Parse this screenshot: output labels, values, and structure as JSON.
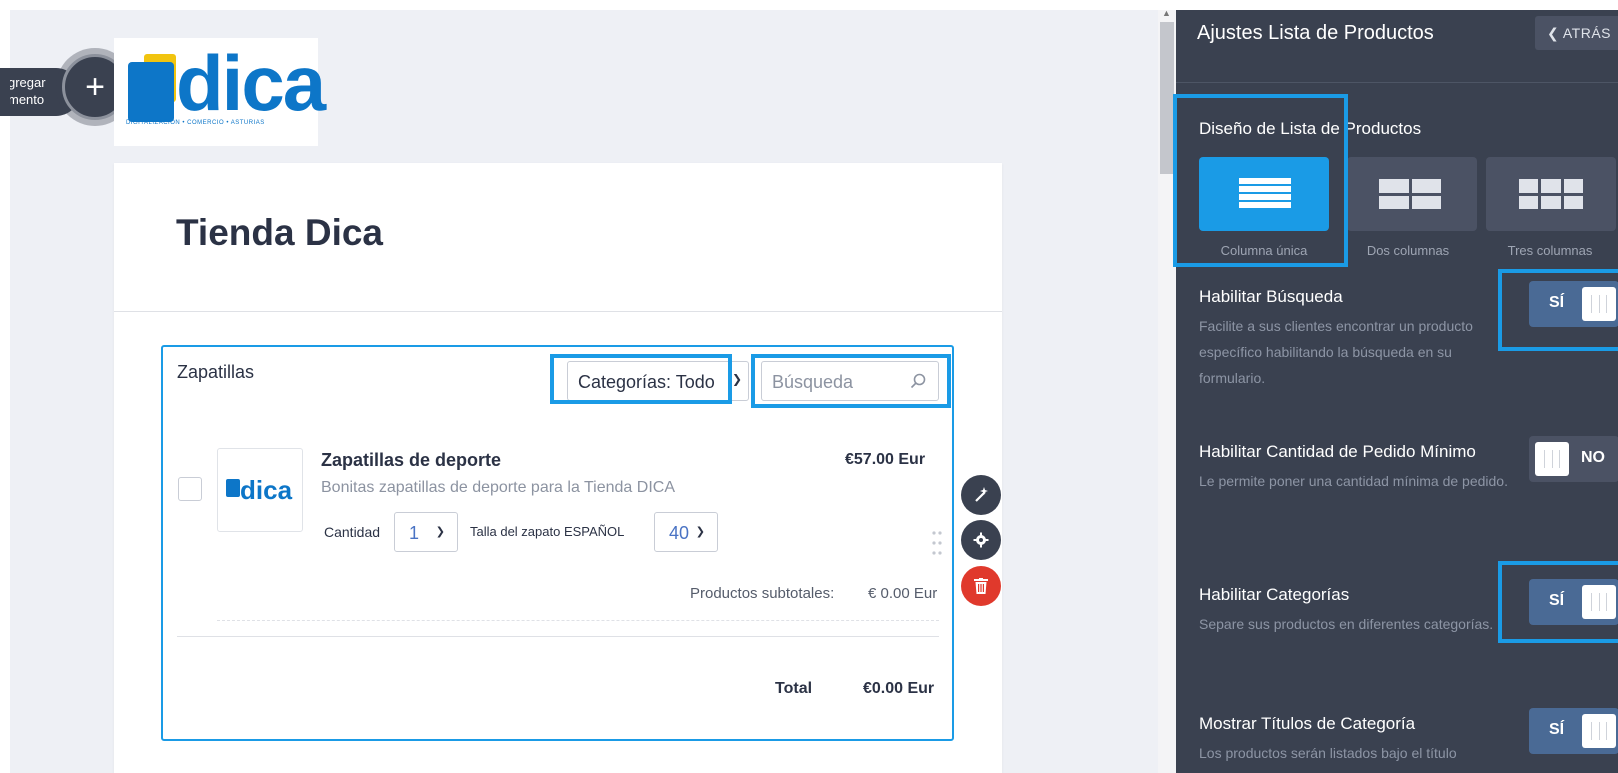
{
  "builder": {
    "add_element_label": "gregar\nmento",
    "add_symbol": "+"
  },
  "logo": {
    "text": "dica",
    "subtitle": "DIGITALIZACIÓN • COMERCIO • ASTURIAS"
  },
  "form": {
    "title": "Tienda Dica",
    "product_list": {
      "label": "Zapatillas",
      "category_filter": "Categorías: Todo",
      "search_placeholder": "Búsqueda",
      "product": {
        "name": "Zapatillas de deporte",
        "description": "Bonitas zapatillas de deporte para la Tienda DICA",
        "price": "€57.00 Eur",
        "thumb_text": "dica",
        "quantity_label": "Cantidad",
        "quantity_value": "1",
        "size_label": "Talla del zapato ESPAÑOL",
        "size_value": "40"
      },
      "subtotal_label": "Productos subtotales:",
      "subtotal_value": "€ 0.00 Eur",
      "total_label": "Total",
      "total_value": "€0.00 Eur"
    }
  },
  "panel": {
    "title": "Ajustes Lista de Productos",
    "back_label": "ATRÁS",
    "layout": {
      "title": "Diseño de Lista de Productos",
      "options": [
        "Columna única",
        "Dos columnas",
        "Tres columnas"
      ],
      "selected": "Columna única"
    },
    "settings": [
      {
        "title": "Habilitar Búsqueda",
        "description": "Facilite a sus clientes encontrar un producto específico habilitando la búsqueda en su formulario.",
        "toggle": "SÍ"
      },
      {
        "title": "Habilitar Cantidad de Pedido Mínimo",
        "description": "Le permite poner una cantidad mínima de pedido.",
        "toggle": "NO"
      },
      {
        "title": "Habilitar Categorías",
        "description": "Separe sus productos en diferentes categorías.",
        "toggle": "SÍ"
      },
      {
        "title": "Mostrar Títulos de Categoría",
        "description": "Los productos serán listados bajo el título",
        "toggle": "SÍ"
      }
    ]
  },
  "colors": {
    "accent": "#1a9be6",
    "panel_bg": "#3a4150",
    "delete": "#e0392c",
    "brand": "#0d76c8"
  }
}
